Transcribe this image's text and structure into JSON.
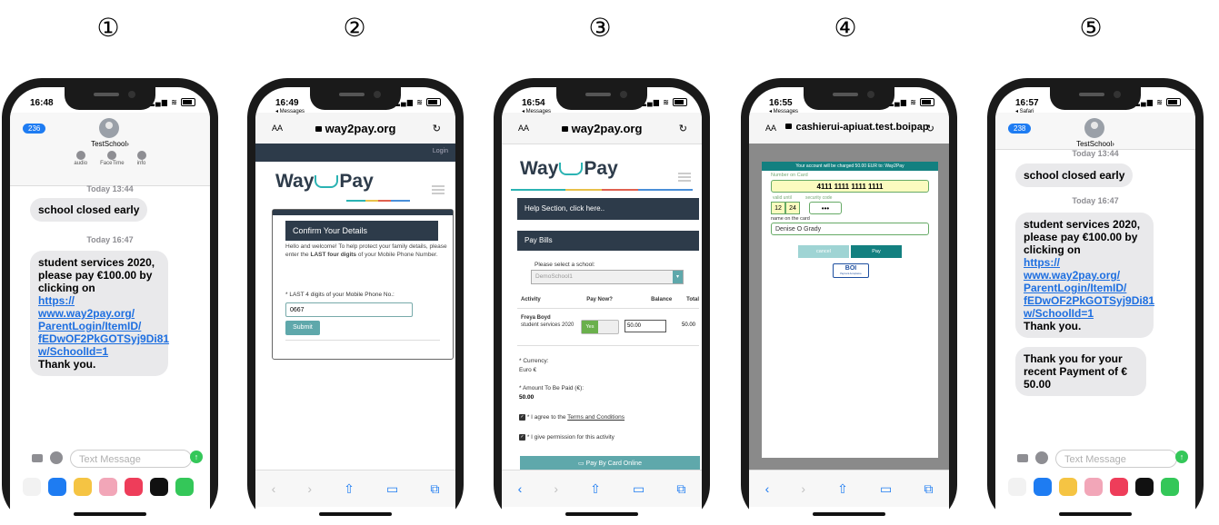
{
  "steps": [
    "①",
    "②",
    "③",
    "④",
    "⑤"
  ],
  "phone1": {
    "time": "16:48",
    "badge": "236",
    "contact": "TestSchool",
    "header_actions": [
      "audio",
      "FaceTime",
      "info"
    ],
    "day1": "Today 13:44",
    "msg1": "school closed early",
    "day2": "Today 16:47",
    "msg2_text": "student services 2020, please pay €100.00 by clicking on",
    "msg2_link": "https:// www.way2pay.org/ ParentLogin/ItemID/ fEDwOF2PkGOTSyj9Di81 w/SchoolId=1",
    "msg2_end": "Thank you.",
    "compose_placeholder": "Text Message"
  },
  "phone2": {
    "time": "16:49",
    "back": "◂ Messages",
    "aa": "AA",
    "url": "way2pay.org",
    "login": "Login",
    "logo_left": "Way",
    "logo_right": "Pay",
    "panel_title": "Confirm Your Details",
    "panel_text_1": "Hello and welcome! To help protect your family details, please enter the",
    "panel_text_bold": "LAST four digits",
    "panel_text_2": "of your Mobile Phone Number.",
    "field_label": "* LAST 4 digits of your Mobile Phone No.:",
    "field_value": "0667",
    "submit": "Submit"
  },
  "phone3": {
    "time": "16:54",
    "back": "◂ Messages",
    "aa": "AA",
    "url": "way2pay.org",
    "logo_left": "Way",
    "logo_right": "Pay",
    "help": "Help Section, click here..",
    "pay_bills": "Pay Bills",
    "select_label": "Please select a school:",
    "select_value": "DemoSchool1",
    "table_headers": [
      "Activity",
      "Pay Now?",
      "Balance",
      "Total"
    ],
    "row_name": "Freya Boyd",
    "row_activity": "student services 2020",
    "row_toggle": "Yes",
    "row_balance": "50.00",
    "row_total": "50.00",
    "currency_label": "* Currency:",
    "currency_value": "Euro €",
    "amount_label": "* Amount To Be Paid (€):",
    "amount_value": "50.00",
    "agree_text": "* I agree to the",
    "agree_link": "Terms and Conditions",
    "permission_text": "* I give permission for this activity",
    "pay_button": "Pay By Card Online"
  },
  "phone4": {
    "time": "16:55",
    "back": "◂ Messages",
    "aa": "AA",
    "url": "cashierui-apiuat.test.boipap",
    "banner": "Your account will be charged 50.00 EUR to: Way2Pay",
    "card_label": "Number on Card",
    "card_value": "4111 1111 1111 1111",
    "valid_label": "valid until",
    "security_label": "security code",
    "month": "12",
    "year": "24",
    "cvv": "•••",
    "name_label": "name on the card",
    "name_value": "Denise O Grady",
    "cancel": "cancel",
    "pay": "Pay",
    "boi": "BOI",
    "boi_sub": "Payment Acceptance"
  },
  "phone5": {
    "time": "16:57",
    "back": "◂ Safari",
    "badge": "238",
    "contact": "TestSchool",
    "day1": "Today 13:44",
    "msg1": "school closed early",
    "day2": "Today 16:47",
    "msg2_text": "student services 2020, please pay €100.00 by clicking on",
    "msg2_link": "https:// www.way2pay.org/ ParentLogin/ItemID/ fEDwOF2PkGOTSyj9Di81 w/SchoolId=1",
    "msg2_end": "Thank you.",
    "msg3": "Thank you for your recent Payment of € 50.00",
    "compose_placeholder": "Text Message"
  },
  "colors": {
    "imessage_blue": "#1e7cf2",
    "waypay_dark": "#2d3b4a",
    "waypay_teal": "#5fa8ab",
    "boi_green": "#138080"
  }
}
